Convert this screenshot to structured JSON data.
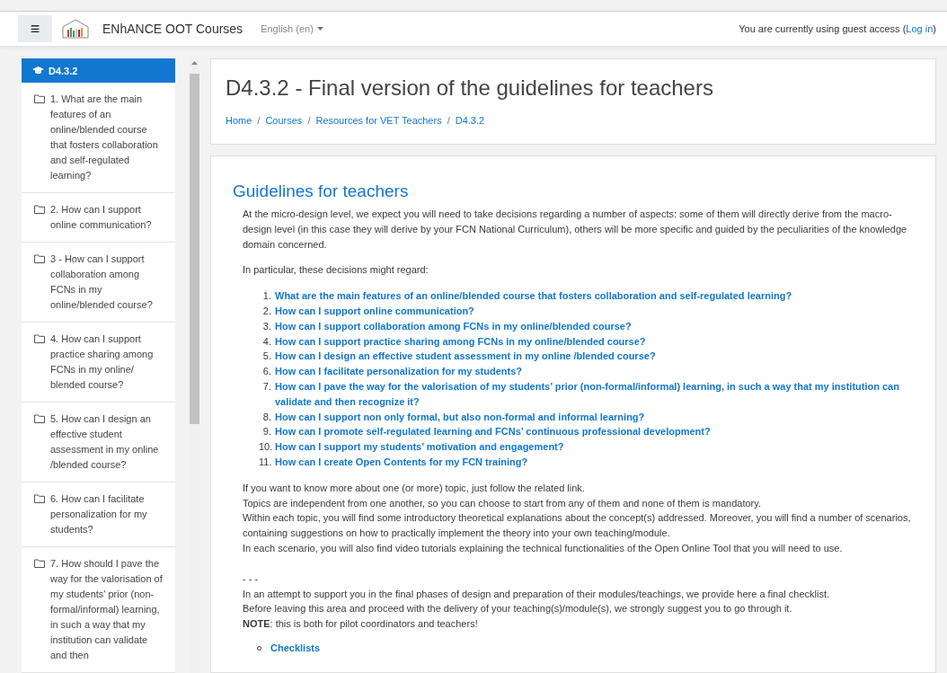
{
  "navbar": {
    "menu_icon": "≡",
    "site_name": "ENhANCE OOT Courses",
    "language": "English (en)",
    "guest_text": "You are currently using guest access (",
    "login_link": "Log in",
    "guest_end": ")"
  },
  "sidebar": {
    "items": [
      {
        "kind": "header",
        "label": "D4.3.2",
        "selected": true
      },
      {
        "kind": "section",
        "label": "1. What are the main features of an online/blended course that fosters collaboration and self-regulated learning?",
        "selected": false
      },
      {
        "kind": "section",
        "label": "2. How can I support online communication?",
        "selected": false
      },
      {
        "kind": "section",
        "label": "3 - How can I support collaboration among FCNs in my online/blended course?",
        "selected": false
      },
      {
        "kind": "section",
        "label": "4. How can I support practice sharing among FCNs in my online/ blended course?",
        "selected": false
      },
      {
        "kind": "section",
        "label": "5. How can I design an effective student assessment in my online /blended course?",
        "selected": false
      },
      {
        "kind": "section",
        "label": "6. How can I facilitate personalization for my students?",
        "selected": false
      },
      {
        "kind": "section",
        "label": "7. How should I pave the way for the valorisation of my students' prior (non-formal/informal) learning, in such a way that my institution can validate and then",
        "selected": false
      }
    ]
  },
  "header": {
    "title": "D4.3.2 - Final version of the guidelines for teachers",
    "breadcrumb_separator": "/",
    "breadcrumb": [
      "Home",
      "Courses",
      "Resources for VET Teachers",
      "D4.3.2"
    ]
  },
  "content": {
    "heading": "Guidelines for teachers",
    "intro": "At the micro-design level, we expect you will need to take decisions regarding a number of aspects: some of them will directly derive from the macro-design level (in this case they will derive by your FCN National Curriculum), others will be more specific and guided by the peculiarities of the knowledge domain concerned.",
    "lead": "In particular, these decisions might regard:",
    "topics": [
      {
        "number": "1.",
        "label": "What are the main features of an online/blended course that fosters collaboration and self-regulated learning?"
      },
      {
        "number": "2.",
        "label": "How can I support online communication?"
      },
      {
        "number": "3.",
        "label": "How can I support collaboration among FCNs in my online/blended course?"
      },
      {
        "number": "4.",
        "label": "How can I support practice sharing among FCNs in my online/blended course?"
      },
      {
        "number": "5.",
        "label": "How can I design an effective student assessment in my online /blended course?"
      },
      {
        "number": "6.",
        "label": "How can I facilitate personalization for my students?"
      },
      {
        "number": "7.",
        "label": "How can I pave the way for the valorisation of my students’ prior (non-formal/informal) learning, in such a way that my institution can validate and then recognize it?"
      },
      {
        "number": "8.",
        "label": "How can I support non only formal, but also non-formal and informal learning?"
      },
      {
        "number": "9.",
        "label": "How can I promote self-regulated learning and FCNs’ continuous professional development?"
      },
      {
        "number": "10.",
        "label": "How can I support my students’ motivation and engagement?"
      },
      {
        "number": "11.",
        "label": "How can I create Open Contents for my FCN training?"
      }
    ],
    "notes": [
      "If you want to know more about one (or more) topic, just follow the related link.",
      "Topics are independent from one another, so you can choose to start from any of them and none of them is mandatory.",
      "Within each topic, you will find some introductory theoretical explanations about the concept(s) addressed. Moreover, you will find a number of scenarios, containing suggestions on how to practically implement the theory into your own teaching/module.",
      "In each scenario, you will also find video tutorials explaining the technical functionalities of the Open Online Tool that you will need to use."
    ],
    "separator": "- - -",
    "checklist_notes": [
      "In an attempt to support you in the final phases of design and preparation of their modules/teachings, we provide here a final checklist.",
      "Before leaving this area and proceed with the delivery of your teaching(s)/module(s), we strongly suggest you to go through it.",
      "**NOTE**: this is both for pilot coordinators and teachers!"
    ],
    "links": [
      "Checklists"
    ]
  }
}
